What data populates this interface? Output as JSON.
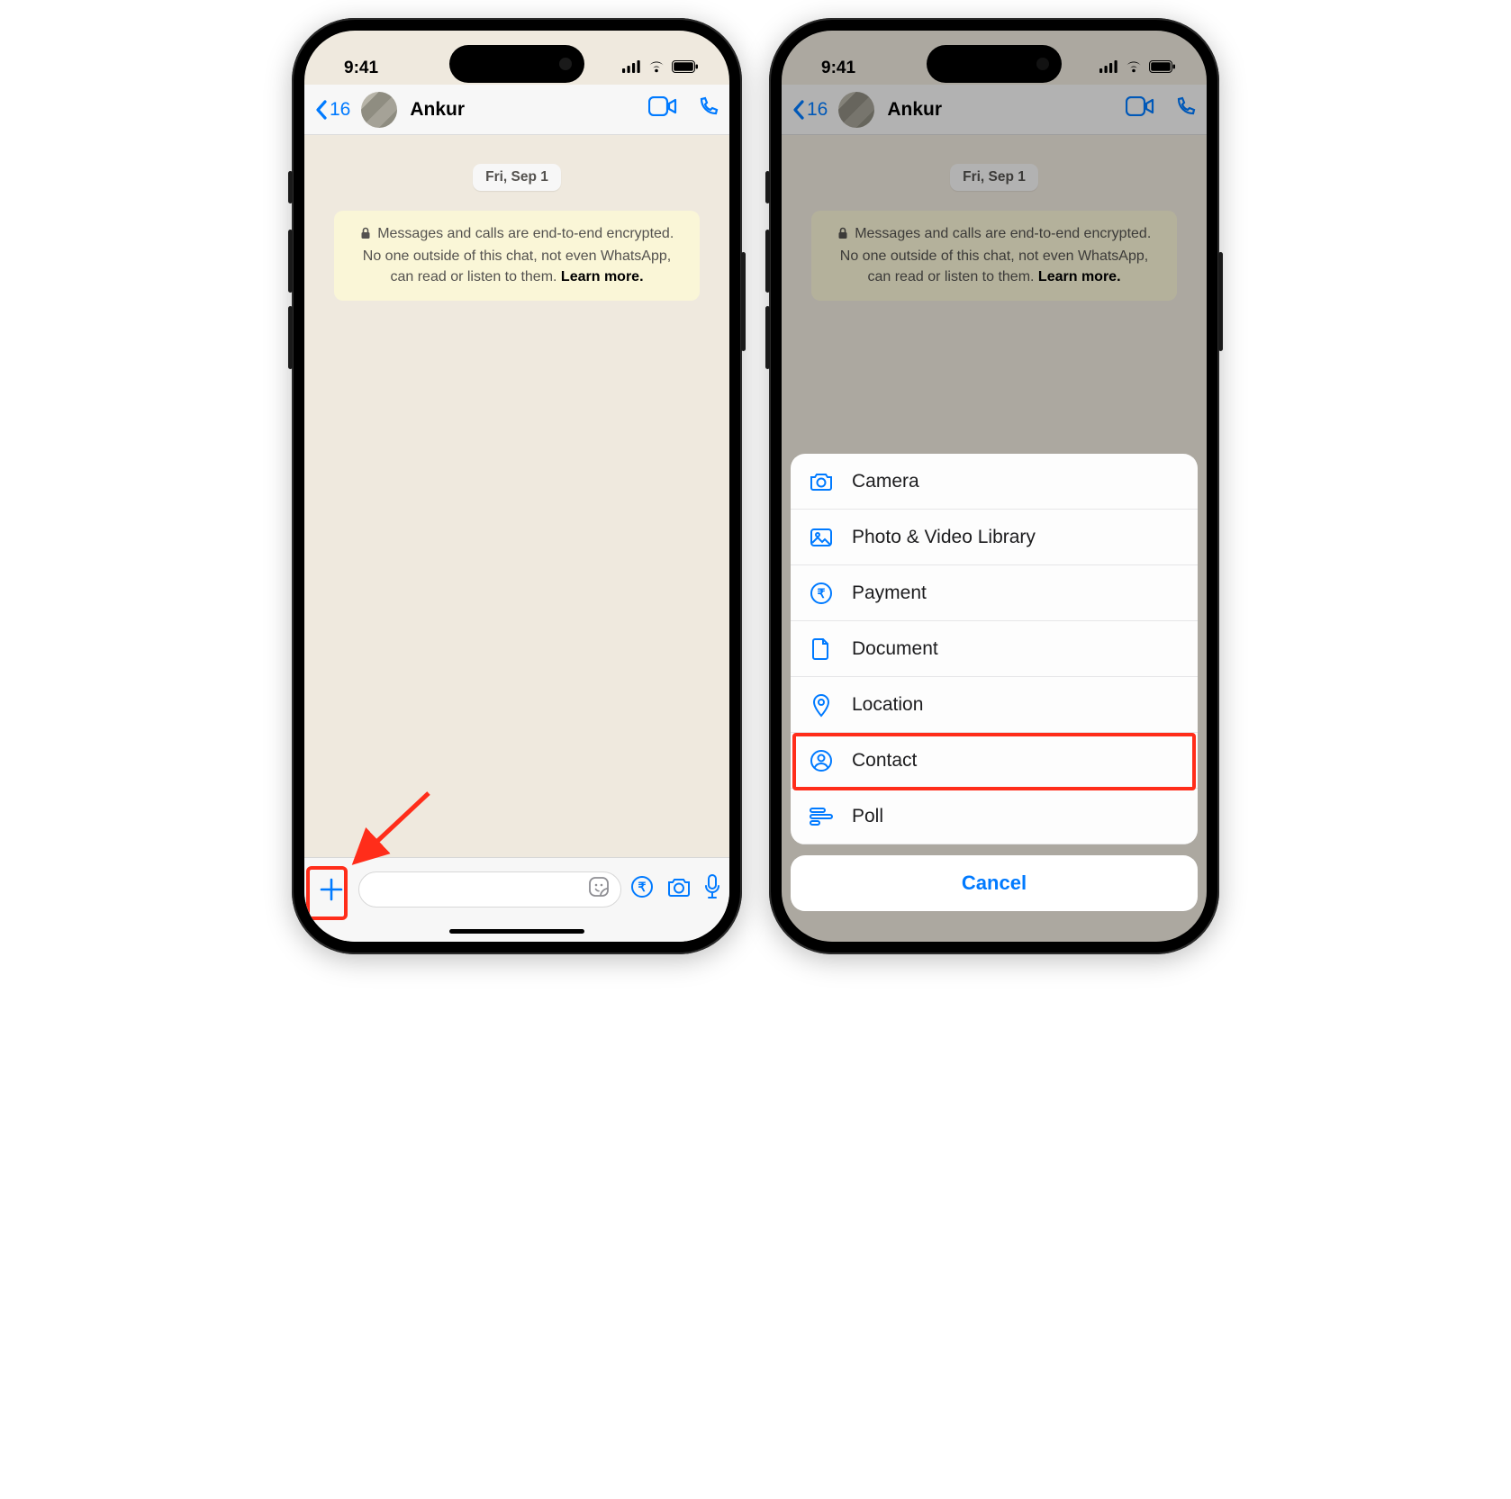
{
  "status": {
    "time": "9:41"
  },
  "nav": {
    "back_count": "16",
    "contact_name": "Ankur"
  },
  "chat": {
    "date": "Fri, Sep 1",
    "encryption_line1": "Messages and calls are end-to-end encrypted.",
    "encryption_line2": "No one outside of this chat, not even WhatsApp,",
    "encryption_line3_prefix": "can read or listen to them. ",
    "encryption_learn_more": "Learn more."
  },
  "sheet": {
    "items": [
      {
        "label": "Camera"
      },
      {
        "label": "Photo & Video Library"
      },
      {
        "label": "Payment"
      },
      {
        "label": "Document"
      },
      {
        "label": "Location"
      },
      {
        "label": "Contact"
      },
      {
        "label": "Poll"
      }
    ],
    "cancel": "Cancel"
  }
}
